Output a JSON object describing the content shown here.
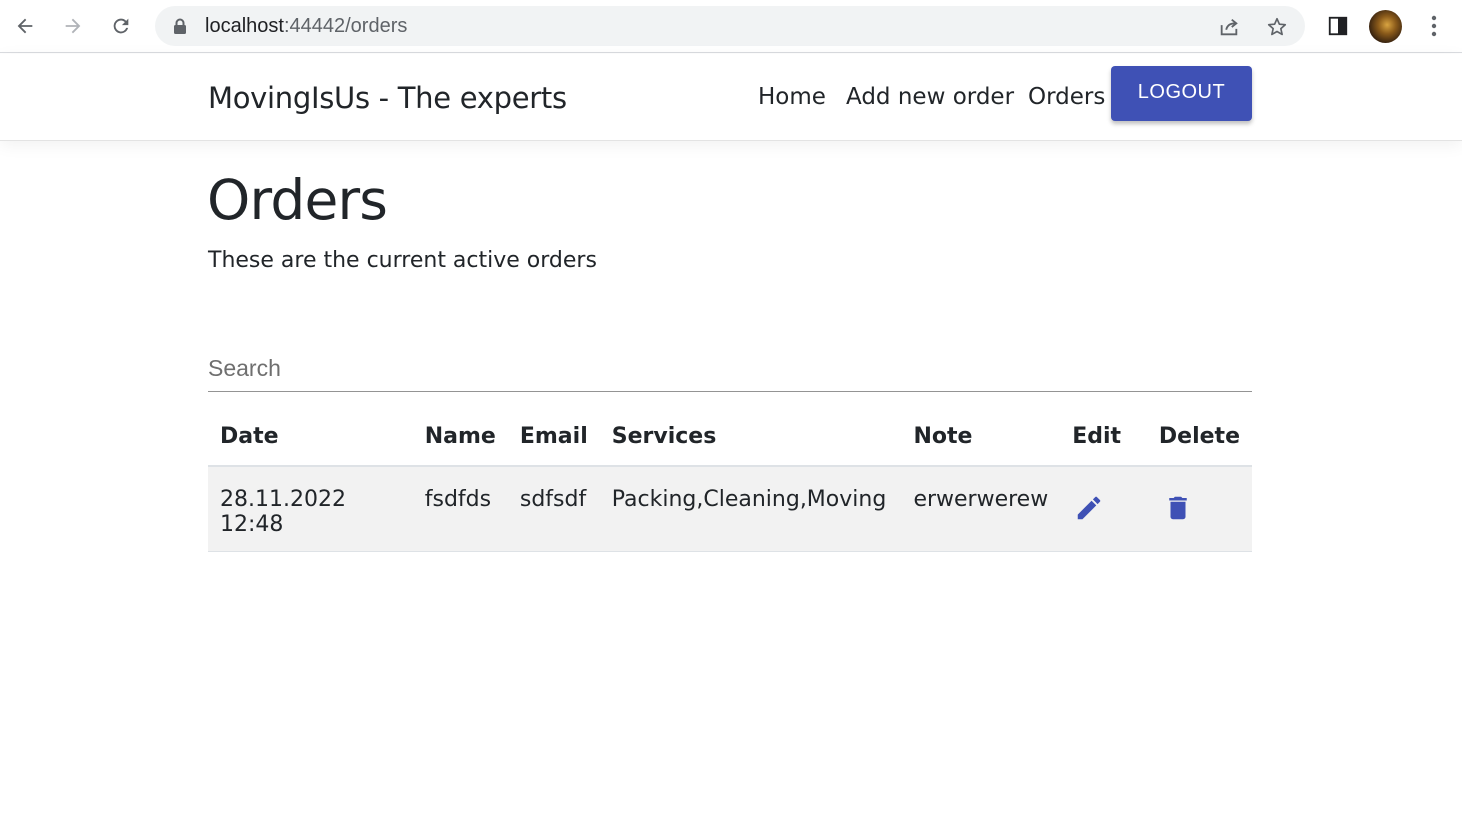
{
  "browser": {
    "url_host": "localhost",
    "url_rest": ":44442/orders",
    "icons": {
      "back": "back-arrow-icon",
      "forward": "forward-arrow-icon",
      "reload": "reload-icon",
      "lock": "lock-icon",
      "share": "share-icon",
      "bookmark": "star-icon",
      "sidepanel": "side-panel-icon",
      "profile": "avatar",
      "menu": "kebab-menu-icon"
    }
  },
  "navbar": {
    "brand": "MovingIsUs - The experts",
    "links": [
      "Home",
      "Add new order",
      "Orders"
    ],
    "logout_label": "LOGOUT"
  },
  "page": {
    "title": "Orders",
    "subtitle": "These are the current active orders"
  },
  "search": {
    "placeholder": "Search",
    "value": ""
  },
  "table": {
    "headers": [
      "Date",
      "Name",
      "Email",
      "Services",
      "Note",
      "Edit",
      "Delete"
    ],
    "rows": [
      {
        "date": "28.11.2022 12:48",
        "name": "fsdfds",
        "email": "sdfsdf",
        "services": "Packing,Cleaning,Moving",
        "note": "erwerwerew",
        "edit_icon": "pencil-icon",
        "delete_icon": "trash-icon"
      }
    ]
  },
  "colors": {
    "accent": "#3f51b5",
    "row_background": "#f2f2f2",
    "text": "#212529"
  }
}
